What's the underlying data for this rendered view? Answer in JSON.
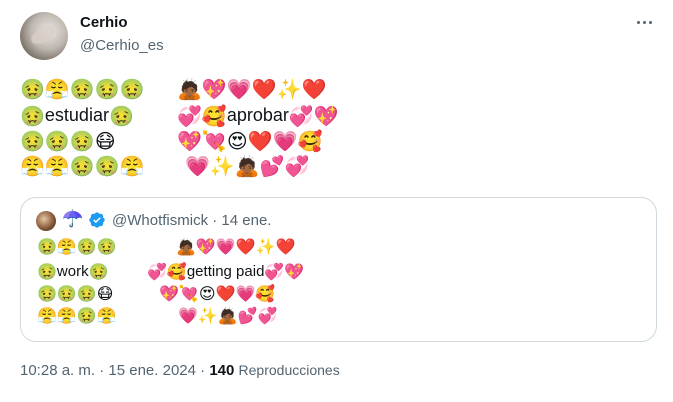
{
  "author": {
    "name": "Cerhio",
    "handle": "@Cerhio_es"
  },
  "tweet": {
    "left_lines": [
      [
        "🤢",
        "😤",
        "🤢",
        "🤢",
        "🤢"
      ],
      [
        "🤢",
        "estudiar",
        "🤢"
      ],
      [
        "🤢",
        "🤢",
        "🤢",
        "😷"
      ],
      [
        "😤",
        "😤",
        "🤢",
        "🤢",
        "😤"
      ]
    ],
    "right_lines": [
      [
        "🙇🏾",
        "💖",
        "💗",
        "❤️",
        "✨",
        "❤️"
      ],
      [
        "💞",
        "🥰",
        "aprobar",
        "💞",
        "💖"
      ],
      [
        "💖",
        "💘",
        "😍",
        "❤️",
        "💗",
        "🥰"
      ],
      [
        "💗",
        "✨",
        "🙇🏾",
        "💕",
        "💞"
      ]
    ]
  },
  "quoted": {
    "umbrella": "☂️",
    "handle": "@Whotfismick",
    "date": "14 ene.",
    "left_lines": [
      [
        "🤢",
        "😤",
        "🤢",
        "🤢"
      ],
      [
        "🤢",
        "work",
        "🤢"
      ],
      [
        "🤢",
        "🤢",
        "🤢",
        "😷"
      ],
      [
        "😤",
        "😤",
        "🤢",
        "😤"
      ]
    ],
    "right_lines": [
      [
        "🙇🏾",
        "💖",
        "💗",
        "❤️",
        "✨",
        "❤️"
      ],
      [
        "💞",
        "🥰",
        "getting paid",
        "💞",
        "💖"
      ],
      [
        "💖",
        "💘",
        "😍",
        "❤️",
        "💗",
        "🥰"
      ],
      [
        "💗",
        "✨",
        "🙇🏾",
        "💕",
        "💞"
      ]
    ]
  },
  "meta": {
    "time": "10:28 a. m.",
    "date": "15 ene. 2024",
    "views_count": "140",
    "views_label": "Reproducciones"
  },
  "colors": {
    "text": "#0f1419",
    "secondary": "#536471",
    "border": "#cfd9de",
    "verified": "#1d9bf0"
  },
  "icons": {
    "more": "more-icon",
    "verified": "verified-badge-icon"
  }
}
